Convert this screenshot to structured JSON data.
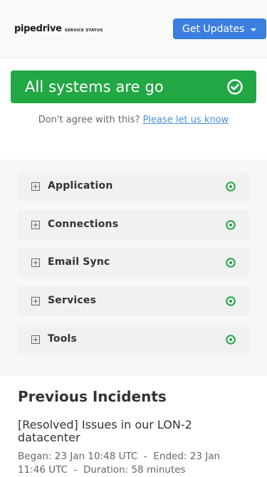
{
  "header": {
    "logo_text": "pipedrive",
    "logo_sub": "SERVICE STATUS",
    "updates_button": "Get Updates"
  },
  "status": {
    "message": "All systems are go",
    "disagree_text": "Don't agree with this?",
    "feedback_link": "Please let us know"
  },
  "components": [
    {
      "name": "Application",
      "status": "operational"
    },
    {
      "name": "Connections",
      "status": "operational"
    },
    {
      "name": "Email Sync",
      "status": "operational"
    },
    {
      "name": "Services",
      "status": "operational"
    },
    {
      "name": "Tools",
      "status": "operational"
    }
  ],
  "incidents": {
    "title": "Previous Incidents",
    "items": [
      {
        "title": "[Resolved] Issues in our LON-2 datacenter",
        "meta_line1": "Began: 23 Jan 10:48 UTC  -  Ended: 23 Jan",
        "meta_line2": "11:46 UTC  -  Duration: 58 minutes"
      }
    ]
  },
  "colors": {
    "brand_blue": "#3d7fe0",
    "status_green": "#22a745",
    "link": "#4a90d9"
  },
  "icons": {
    "expand": "plus-square-icon",
    "ok": "check-circle-icon",
    "caret": "caret-down-icon"
  }
}
